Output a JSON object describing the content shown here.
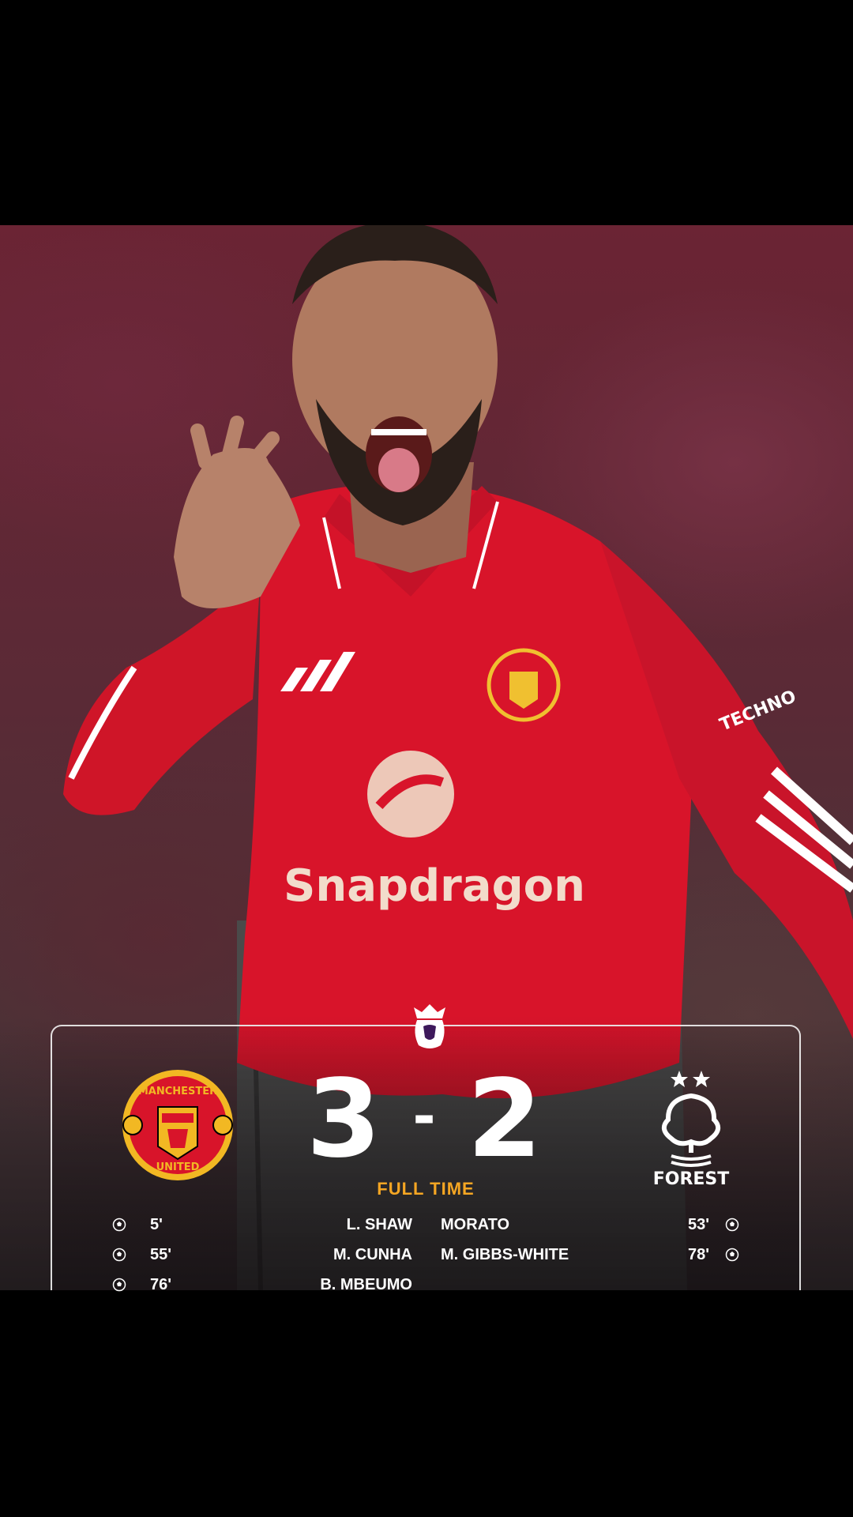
{
  "match": {
    "home_score": "3",
    "separator": "-",
    "away_score": "2",
    "status": "FULL TIME"
  },
  "home_team": {
    "crest_text_top": "MANCHESTER",
    "crest_text_bottom": "UNITED"
  },
  "away_team": {
    "crest_text": "FOREST"
  },
  "home_scorers": [
    {
      "name": "L. SHAW",
      "minute": "5'"
    },
    {
      "name": "M. CUNHA",
      "minute": "55'"
    },
    {
      "name": "B. MBEUMO",
      "minute": "76'"
    }
  ],
  "away_scorers": [
    {
      "name": "MORATO",
      "minute": "53'"
    },
    {
      "name": "M. GIBBS-WHITE",
      "minute": "78'"
    }
  ],
  "shirt": {
    "sponsor": "Snapdragon",
    "sleeve_text": "TECHNO"
  },
  "colors": {
    "accent": "#f5a623",
    "united_red": "#d8142a",
    "shorts": "#4a4a4a",
    "background": "#000000"
  },
  "icons": [
    "premier-league-lion-icon",
    "soccer-ball-icon"
  ]
}
